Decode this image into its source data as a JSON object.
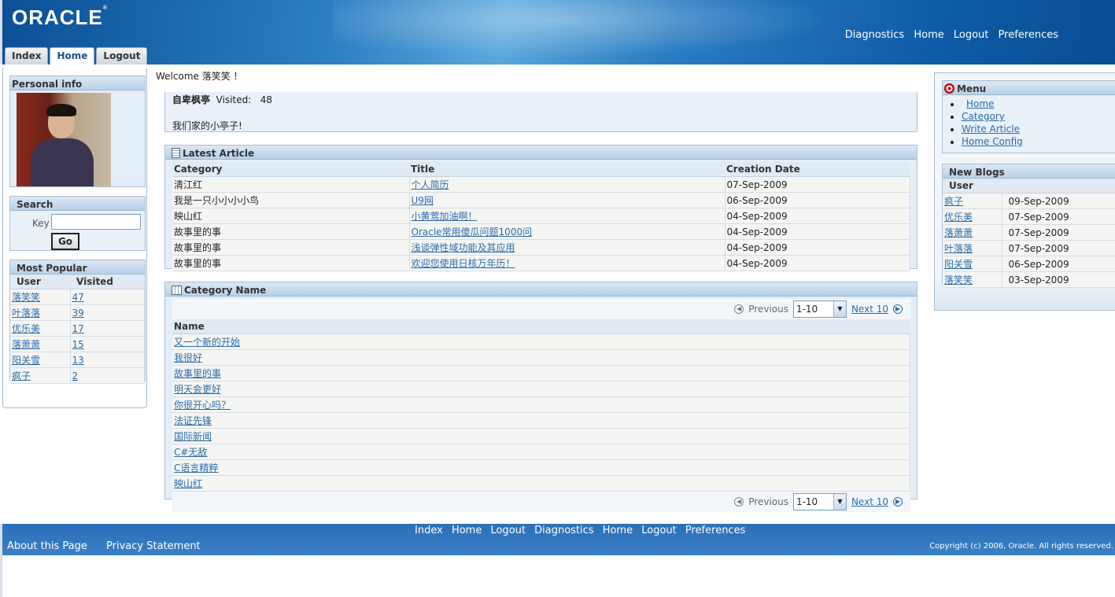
{
  "header": {
    "logo": "ORACLE",
    "global_links": [
      "Diagnostics",
      "Home",
      "Logout",
      "Preferences"
    ],
    "tabs": [
      "Index",
      "Home",
      "Logout"
    ],
    "active_tab": "Home"
  },
  "welcome": "Welcome 落笑笑 ！",
  "personal_info": {
    "title": "Personal info"
  },
  "search": {
    "title": "Search",
    "key_label": "Key",
    "key_value": "",
    "go_label": "Go"
  },
  "most_popular": {
    "title": "Most Popular",
    "columns": [
      "User",
      "Visited"
    ],
    "rows": [
      [
        "落笑笑",
        "47"
      ],
      [
        "叶落落",
        "39"
      ],
      [
        "优乐美",
        "17"
      ],
      [
        "落萧萧",
        "15"
      ],
      [
        "阳关雪",
        "13"
      ],
      [
        "疯子",
        "2"
      ]
    ]
  },
  "blog_info": {
    "name": "自卑枫亭",
    "visited_label": "Visited:",
    "visited": "48",
    "description": "我们家的小亭子!"
  },
  "latest_article": {
    "title": "Latest Article",
    "columns": [
      "Category",
      "Title",
      "Creation Date"
    ],
    "rows": [
      [
        "清江红",
        "个人简历",
        "07-Sep-2009"
      ],
      [
        "我是一只小小小小鸟",
        "U9网",
        "06-Sep-2009"
      ],
      [
        "映山红",
        "小黄莺加油啊！",
        "04-Sep-2009"
      ],
      [
        "故事里的事",
        "Oracle常用傻瓜问题1000问",
        "04-Sep-2009"
      ],
      [
        "故事里的事",
        "浅谈弹性域功能及其应用",
        "04-Sep-2009"
      ],
      [
        "故事里的事",
        "欢迎您使用日核万年历！",
        "04-Sep-2009"
      ]
    ]
  },
  "category_name": {
    "title": "Category Name",
    "previous_label": "Previous",
    "range_value": "1-10",
    "next_label": "Next 10",
    "column": "Name",
    "rows": [
      "又一个新的开始",
      "我很好",
      "故事里的事",
      "明天会更好",
      "你很开心吗？",
      "法证先锋",
      "国际新闻",
      "C#无敌",
      "C语言精粹",
      "映山红"
    ]
  },
  "menu": {
    "title": "Menu",
    "items": [
      "Home",
      "Category",
      "Write Article",
      "Home Config"
    ]
  },
  "new_blogs": {
    "title": "New Blogs",
    "column": "User",
    "rows": [
      [
        "疯子",
        "09-Sep-2009"
      ],
      [
        "优乐美",
        "07-Sep-2009"
      ],
      [
        "落萧萧",
        "07-Sep-2009"
      ],
      [
        "叶落落",
        "07-Sep-2009"
      ],
      [
        "阳关雪",
        "06-Sep-2009"
      ],
      [
        "落笑笑",
        "03-Sep-2009"
      ]
    ]
  },
  "footer": {
    "links": [
      "Index",
      "Home",
      "Logout",
      "Diagnostics",
      "Home",
      "Logout",
      "Preferences"
    ],
    "about": "About this Page",
    "privacy": "Privacy Statement",
    "copyright": "Copyright (c) 2006, Oracle. All rights reserved."
  }
}
